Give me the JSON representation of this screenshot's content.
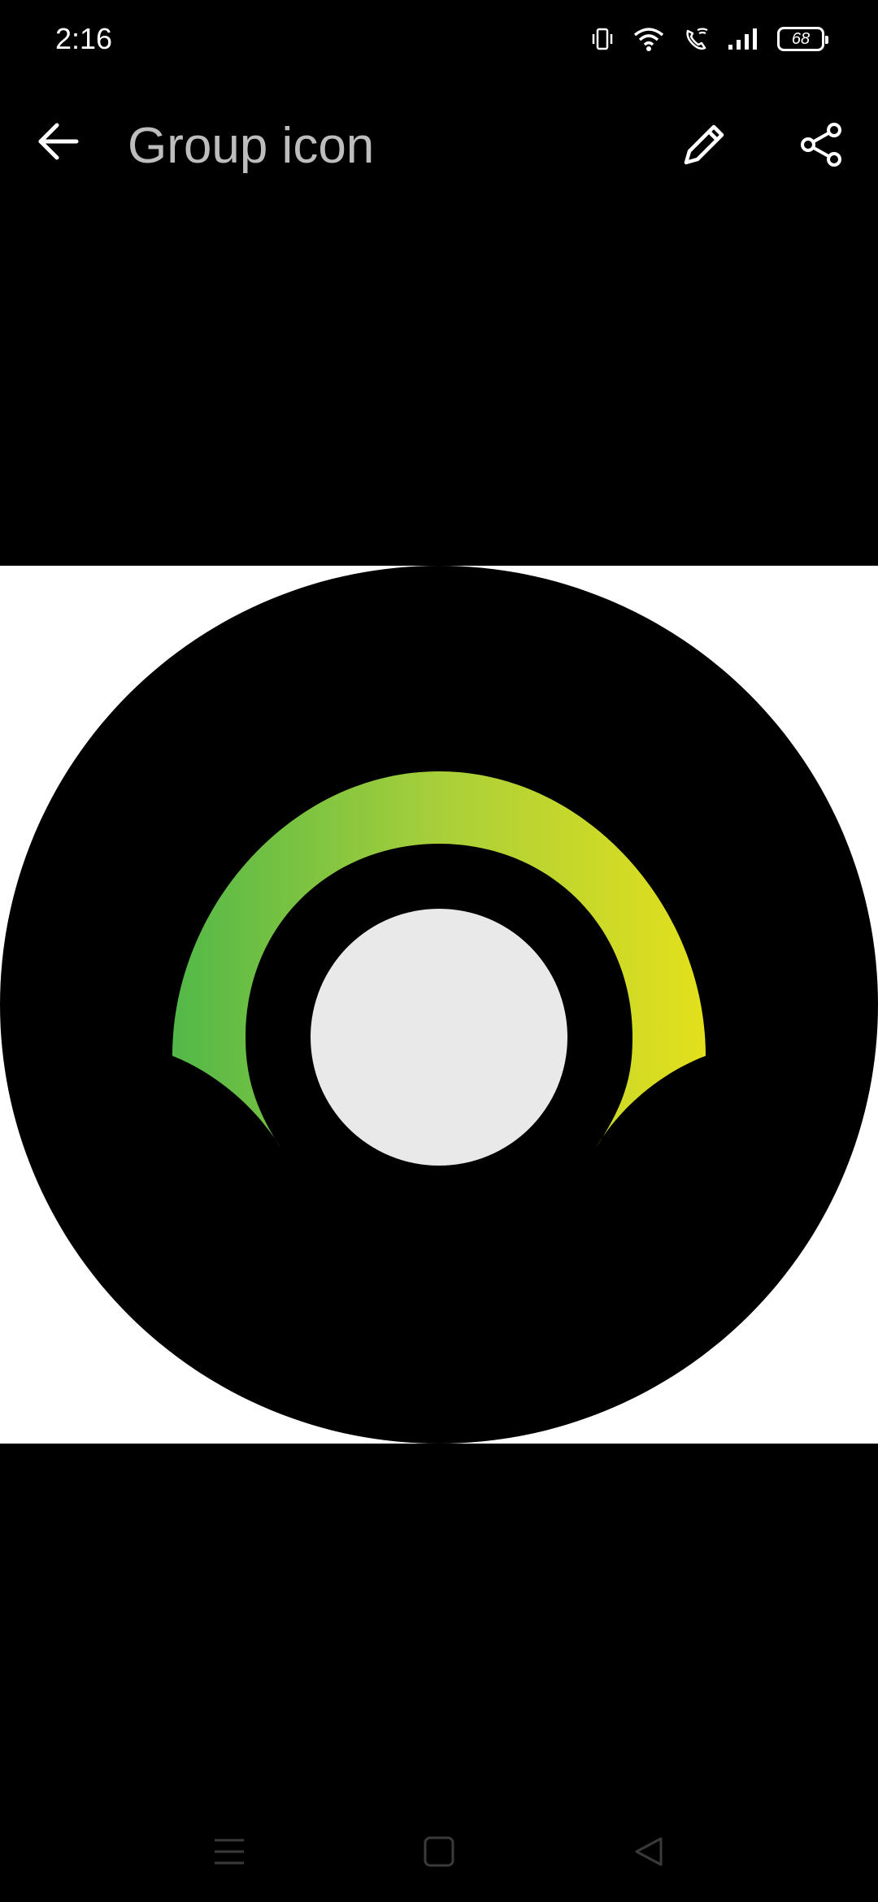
{
  "status_bar": {
    "time": "2:16",
    "battery_level": "68",
    "icons": [
      "vibrate-icon",
      "wifi-icon",
      "wifi-call-icon",
      "signal-icon",
      "battery-icon"
    ]
  },
  "app_bar": {
    "title": "Group icon",
    "back_icon": "arrow-left-icon",
    "edit_icon": "pencil-icon",
    "share_icon": "share-icon"
  },
  "image": {
    "description_icon": "group-avatar-image",
    "colors": {
      "outer_background": "#ffffff",
      "circle": "#000000",
      "arc_start": "#52b848",
      "arc_mid": "#a8cf3a",
      "arc_end": "#e3e01c",
      "inner_dot": "#e8e9e8"
    }
  },
  "nav_bar": {
    "icons": [
      "menu-icon",
      "home-icon",
      "back-triangle-icon"
    ],
    "color": "#3a3a3a"
  }
}
